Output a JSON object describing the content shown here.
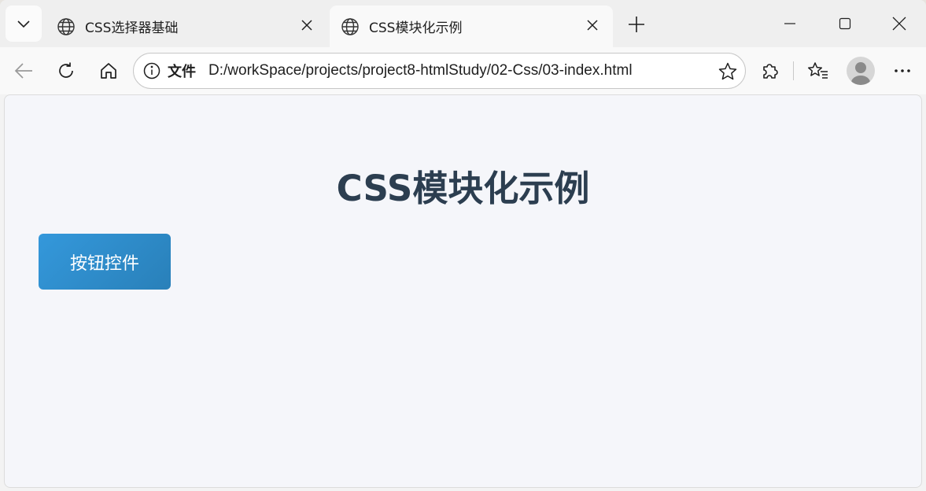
{
  "browser": {
    "tabs": [
      {
        "title": "CSS选择器基础",
        "active": false
      },
      {
        "title": "CSS模块化示例",
        "active": true
      }
    ],
    "address": {
      "scheme_label": "文件",
      "url": "D:/workSpace/projects/project8-htmlStudy/02-Css/03-index.html"
    },
    "icons": {
      "tab_list": "chevron-down-icon",
      "tab_favicon": "globe-icon",
      "tab_close": "close-icon",
      "new_tab": "plus-icon",
      "minimize": "minimize-icon",
      "maximize": "maximize-icon",
      "window_close": "close-icon",
      "back": "back-arrow-icon",
      "refresh": "refresh-icon",
      "home": "home-icon",
      "site_info": "info-icon",
      "favorite": "star-icon",
      "extensions": "puzzle-icon",
      "favorites_list": "favorites-list-icon",
      "profile": "avatar-icon",
      "more": "more-icon"
    }
  },
  "page": {
    "heading": "CSS模块化示例",
    "button_label": "按钮控件"
  },
  "colors": {
    "heading": "#2c3e50",
    "button_gradient_start": "#3498db",
    "button_gradient_end": "#2980b9",
    "page_background": "#f5f6fa"
  }
}
